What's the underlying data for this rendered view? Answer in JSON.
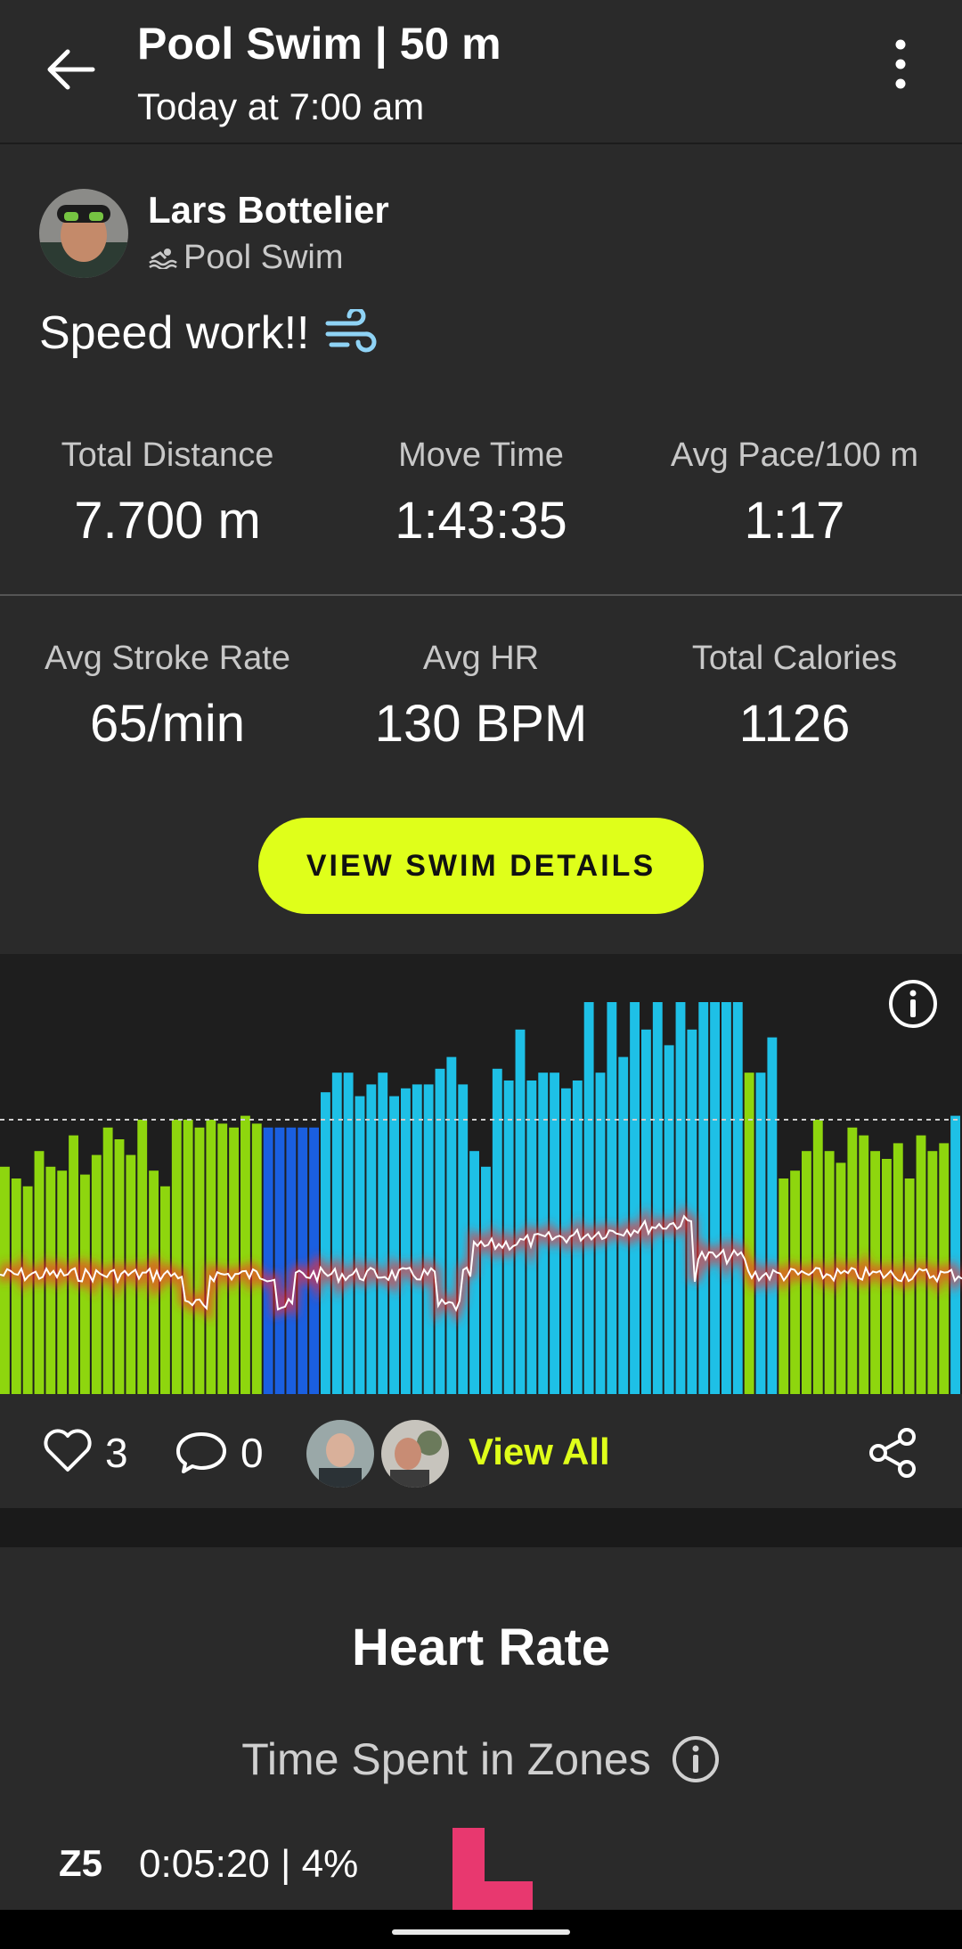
{
  "header": {
    "title": "Pool Swim | 50 m",
    "subtitle": "Today at 7:00 am"
  },
  "post": {
    "author": "Lars Bottelier",
    "activity_type": "Pool Swim",
    "caption": "Speed work!!",
    "caption_emoji": "💨"
  },
  "stats": [
    {
      "label": "Total Distance",
      "value": "7.700 m"
    },
    {
      "label": "Move Time",
      "value": "1:43:35"
    },
    {
      "label": "Avg Pace/100 m",
      "value": "1:17"
    },
    {
      "label": "Avg Stroke Rate",
      "value": "65/min"
    },
    {
      "label": "Avg HR",
      "value": "130 BPM"
    },
    {
      "label": "Total Calories",
      "value": "1126"
    }
  ],
  "details_button": "VIEW SWIM DETAILS",
  "colors": {
    "accent": "#dfff1a",
    "bar_green": "#8ed60e",
    "bar_light_blue": "#1ec0e6",
    "bar_dark_blue": "#1a5fe0",
    "hr_line_glow": "#ff2a2a",
    "zone5": "#e8386f"
  },
  "chart_data": {
    "type": "bar",
    "series": [
      {
        "values": [
          [
            0.58,
            "g"
          ],
          [
            0.55,
            "g"
          ],
          [
            0.53,
            "g"
          ],
          [
            0.62,
            "g"
          ],
          [
            0.58,
            "g"
          ],
          [
            0.57,
            "g"
          ],
          [
            0.66,
            "g"
          ],
          [
            0.56,
            "g"
          ],
          [
            0.61,
            "g"
          ],
          [
            0.68,
            "g"
          ],
          [
            0.65,
            "g"
          ],
          [
            0.61,
            "g"
          ],
          [
            0.7,
            "g"
          ],
          [
            0.57,
            "g"
          ],
          [
            0.53,
            "g"
          ],
          [
            0.7,
            "g"
          ],
          [
            0.7,
            "g"
          ],
          [
            0.68,
            "g"
          ],
          [
            0.7,
            "g"
          ],
          [
            0.69,
            "g"
          ],
          [
            0.68,
            "g"
          ],
          [
            0.71,
            "g"
          ],
          [
            0.69,
            "g"
          ],
          [
            0.68,
            "d"
          ],
          [
            0.68,
            "d"
          ],
          [
            0.68,
            "d"
          ],
          [
            0.68,
            "d"
          ],
          [
            0.68,
            "d"
          ],
          [
            0.77,
            "b"
          ],
          [
            0.82,
            "b"
          ],
          [
            0.82,
            "b"
          ],
          [
            0.76,
            "b"
          ],
          [
            0.79,
            "b"
          ],
          [
            0.82,
            "b"
          ],
          [
            0.76,
            "b"
          ],
          [
            0.78,
            "b"
          ],
          [
            0.79,
            "b"
          ],
          [
            0.79,
            "b"
          ],
          [
            0.83,
            "b"
          ],
          [
            0.86,
            "b"
          ],
          [
            0.79,
            "b"
          ],
          [
            0.62,
            "b"
          ],
          [
            0.58,
            "b"
          ],
          [
            0.83,
            "b"
          ],
          [
            0.8,
            "b"
          ],
          [
            0.93,
            "b"
          ],
          [
            0.8,
            "b"
          ],
          [
            0.82,
            "b"
          ],
          [
            0.82,
            "b"
          ],
          [
            0.78,
            "b"
          ],
          [
            0.8,
            "b"
          ],
          [
            1.0,
            "b"
          ],
          [
            0.82,
            "b"
          ],
          [
            1.0,
            "b"
          ],
          [
            0.86,
            "b"
          ],
          [
            1.0,
            "b"
          ],
          [
            0.93,
            "b"
          ],
          [
            1.0,
            "b"
          ],
          [
            0.89,
            "b"
          ],
          [
            1.0,
            "b"
          ],
          [
            0.93,
            "b"
          ],
          [
            1.0,
            "b"
          ],
          [
            1.0,
            "b"
          ],
          [
            1.0,
            "b"
          ],
          [
            1.0,
            "b"
          ],
          [
            0.82,
            "g"
          ],
          [
            0.82,
            "b"
          ],
          [
            0.91,
            "b"
          ],
          [
            0.55,
            "g"
          ],
          [
            0.57,
            "g"
          ],
          [
            0.62,
            "g"
          ],
          [
            0.7,
            "g"
          ],
          [
            0.62,
            "g"
          ],
          [
            0.59,
            "g"
          ],
          [
            0.68,
            "g"
          ],
          [
            0.66,
            "g"
          ],
          [
            0.62,
            "g"
          ],
          [
            0.6,
            "g"
          ],
          [
            0.64,
            "g"
          ],
          [
            0.55,
            "g"
          ],
          [
            0.66,
            "g"
          ],
          [
            0.62,
            "g"
          ],
          [
            0.64,
            "g"
          ],
          [
            0.71,
            "b"
          ]
        ]
      }
    ],
    "reference_line": 0.7
  },
  "social": {
    "likes": "3",
    "comments": "0",
    "view_all": "View All"
  },
  "heart_rate": {
    "title": "Heart Rate",
    "zones_title": "Time Spent in Zones",
    "zones": [
      {
        "label": "Z5",
        "value": "0:05:20 | 4%"
      }
    ]
  }
}
